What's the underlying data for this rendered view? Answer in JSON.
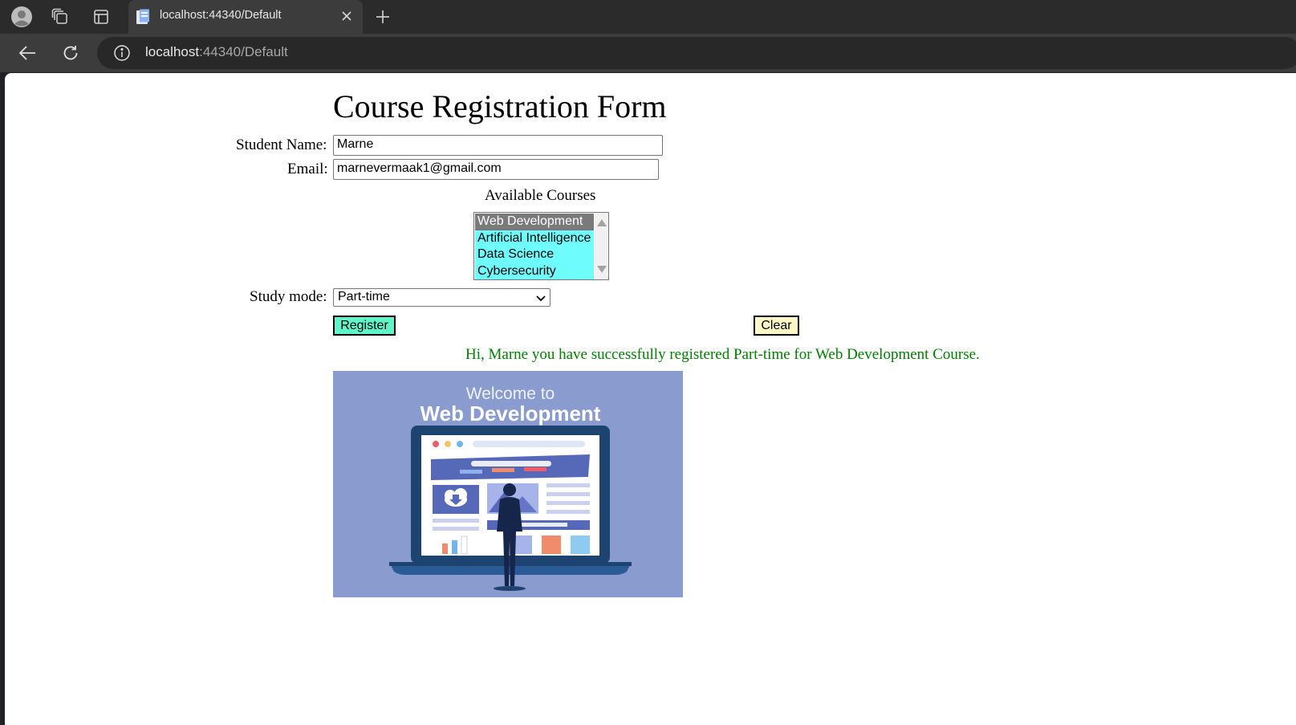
{
  "browser": {
    "tab_title": "localhost:44340/Default",
    "url_host": "localhost",
    "url_rest": ":44340/Default"
  },
  "form": {
    "title": "Course Registration Form",
    "student_name_label": "Student Name:",
    "student_name_value": "Marne",
    "email_label": "Email:",
    "email_value": "marnevermaak1@gmail.com",
    "courses_label": "Available Courses",
    "courses": [
      {
        "label": "Web Development",
        "selected": true
      },
      {
        "label": "Artificial Intelligence",
        "selected": false
      },
      {
        "label": "Data Science",
        "selected": false
      },
      {
        "label": "Cybersecurity",
        "selected": false
      }
    ],
    "study_mode_label": "Study mode:",
    "study_mode_value": "Part-time",
    "register_label": "Register",
    "clear_label": "Clear",
    "message": "Hi, Marne you have successfully registered Part-time for Web Development Course."
  },
  "banner": {
    "welcome_text": "Welcome to",
    "heading_text": "Web Development"
  },
  "colors": {
    "listbox_item": "#6ffcfc",
    "listbox_selected": "#7a7a7a",
    "register_button": "#5ef5c8",
    "clear_button": "#fff8c6",
    "success_message": "#008000",
    "banner_bg": "#8a9bcf"
  },
  "icons": [
    "profile-icon",
    "workspaces-icon",
    "tab-actions-icon",
    "page-icon",
    "close-icon",
    "plus-icon",
    "back-icon",
    "reload-icon",
    "info-icon",
    "chevron-down-icon",
    "scroll-up-icon",
    "scroll-down-icon"
  ]
}
